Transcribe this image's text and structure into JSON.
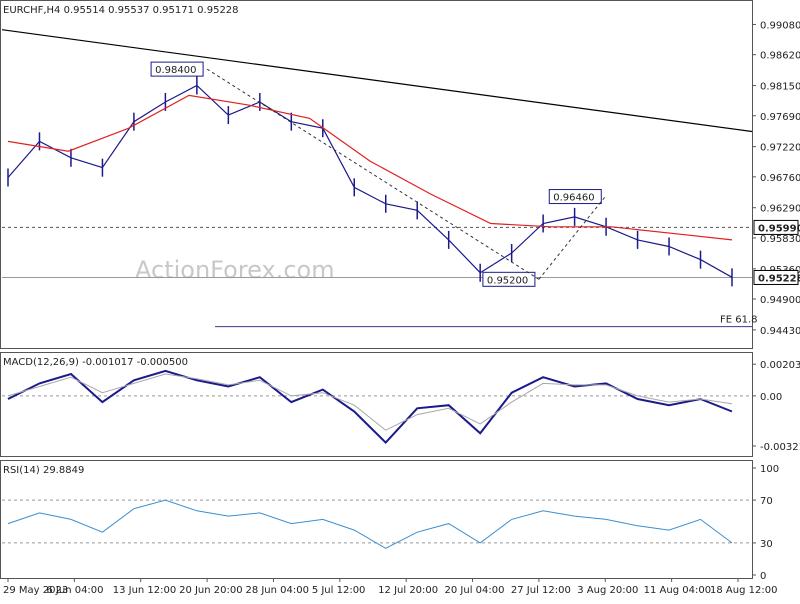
{
  "chart_data": [
    {
      "panel": "price",
      "type": "line",
      "header": "EURCHF,H4  0.95514 0.95537 0.95171 0.95228",
      "watermark": "ActionForex.com",
      "ylim": [
        0.942,
        0.993
      ],
      "y_ticks": [
        "0.99080",
        "0.98620",
        "0.98150",
        "0.97690",
        "0.97220",
        "0.96760",
        "0.96290",
        "0.95830",
        "0.95360",
        "0.94900",
        "0.94430"
      ],
      "x_labels": [
        "29 May 2023",
        "6 Jun 04:00",
        "13 Jun 12:00",
        "20 Jun 20:00",
        "28 Jun 04:00",
        "5 Jul 12:00",
        "12 Jul 20:00",
        "20 Jul 04:00",
        "27 Jul 12:00",
        "3 Aug 20:00",
        "11 Aug 04:00",
        "18 Aug 12:00"
      ],
      "series": [
        {
          "role": "close",
          "color": "#1a1a8c",
          "x": [
            "29 May 2023",
            "2 Jun",
            "6 Jun 04:00",
            "9 Jun",
            "13 Jun 12:00",
            "16 Jun",
            "20 Jun 20:00",
            "24 Jun",
            "28 Jun 04:00",
            "1 Jul",
            "5 Jul 12:00",
            "9 Jul",
            "12 Jul 20:00",
            "16 Jul",
            "20 Jul 04:00",
            "24 Jul",
            "27 Jul 12:00",
            "31 Jul",
            "3 Aug 20:00",
            "7 Aug",
            "11 Aug 04:00",
            "15 Aug",
            "18 Aug 12:00",
            "21 Aug"
          ],
          "values": [
            0.9675,
            0.973,
            0.9705,
            0.969,
            0.976,
            0.979,
            0.9815,
            0.977,
            0.979,
            0.976,
            0.975,
            0.966,
            0.9635,
            0.9625,
            0.958,
            0.953,
            0.956,
            0.9605,
            0.9615,
            0.96,
            0.958,
            0.957,
            0.955,
            0.9523
          ]
        },
        {
          "role": "moving-average",
          "color": "#e02020",
          "x": [
            "29 May 2023",
            "6 Jun 04:00",
            "13 Jun 12:00",
            "20 Jun 20:00",
            "28 Jun 04:00",
            "5 Jul 12:00",
            "12 Jul 20:00",
            "20 Jul 04:00",
            "27 Jul 12:00",
            "3 Aug 20:00",
            "11 Aug 04:00",
            "18 Aug 12:00",
            "21 Aug"
          ],
          "values": [
            0.973,
            0.9715,
            0.975,
            0.98,
            0.9785,
            0.9765,
            0.97,
            0.965,
            0.9605,
            0.96,
            0.96,
            0.959,
            0.958
          ]
        }
      ],
      "annotations": [
        {
          "label": "0.98400",
          "at": "20 Jun 20:00",
          "value": 0.984
        },
        {
          "label": "0.95200",
          "at": "27 Jul 12:00",
          "value": 0.952
        },
        {
          "label": "0.96460",
          "at": "3 Aug 20:00",
          "value": 0.9646
        },
        {
          "label": "0.95990",
          "value": 0.9599,
          "style": "dashed-level",
          "color": "#000000"
        },
        {
          "label": "0.95228",
          "value": 0.95228,
          "style": "current-price",
          "color": "#000000"
        },
        {
          "label": "FE 61.8",
          "value": 0.9448,
          "style": "fib-level"
        }
      ],
      "trendline": {
        "from": [
          "29 May 2023",
          0.99
        ],
        "to": [
          "21 Aug",
          0.9745
        ]
      }
    },
    {
      "panel": "macd",
      "type": "line",
      "header": "MACD(12,26,9) -0.001017 -0.000500",
      "ylim": [
        -0.0036,
        0.0023
      ],
      "y_ticks": [
        "0.002031",
        "0.00",
        "-0.003214"
      ],
      "series": [
        {
          "role": "macd",
          "color": "#1a1a8c",
          "values": [
            -0.0002,
            0.0008,
            0.0014,
            -0.0004,
            0.001,
            0.0016,
            0.001,
            0.0006,
            0.0012,
            -0.0004,
            0.0004,
            -0.001,
            -0.003,
            -0.0008,
            -0.0006,
            -0.0024,
            0.0002,
            0.0012,
            0.0006,
            0.0008,
            -0.0002,
            -0.0006,
            -0.0002,
            -0.001
          ]
        },
        {
          "role": "signal",
          "color": "#a8a8a8",
          "values": [
            0.0,
            0.0006,
            0.0012,
            0.0002,
            0.0008,
            0.0014,
            0.0011,
            0.0007,
            0.001,
            0.0,
            0.0002,
            -0.0006,
            -0.0022,
            -0.0012,
            -0.0008,
            -0.0018,
            -0.0004,
            0.0008,
            0.0007,
            0.0007,
            0.0,
            -0.0004,
            -0.0002,
            -0.0005
          ]
        }
      ]
    },
    {
      "panel": "rsi",
      "type": "line",
      "header": "RSI(14) 29.8849",
      "ylim": [
        0,
        100
      ],
      "y_ticks": [
        "100",
        "70",
        "30",
        "0"
      ],
      "levels": [
        70,
        30
      ],
      "series": [
        {
          "role": "rsi",
          "color": "#3a8fd0",
          "values": [
            48,
            58,
            52,
            40,
            62,
            70,
            60,
            55,
            58,
            48,
            52,
            42,
            25,
            40,
            48,
            30,
            52,
            60,
            55,
            52,
            46,
            42,
            52,
            30
          ]
        }
      ]
    }
  ]
}
